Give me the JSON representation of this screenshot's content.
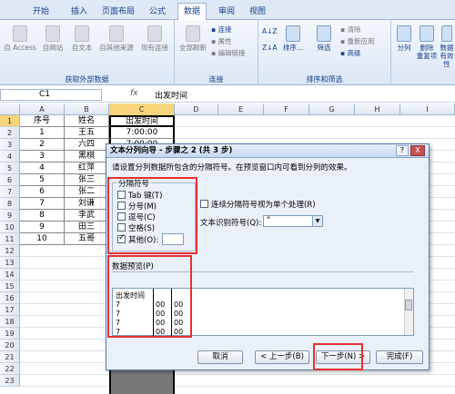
{
  "tabs": [
    {
      "label": "开始",
      "active": false
    },
    {
      "label": "插入",
      "active": false
    },
    {
      "label": "页面布局",
      "active": false
    },
    {
      "label": "公式",
      "active": false
    },
    {
      "label": "数据",
      "active": true
    },
    {
      "label": "审阅",
      "active": false
    },
    {
      "label": "视图",
      "active": false
    }
  ],
  "ribbon": {
    "groups": {
      "external": "获取外部数据",
      "connections": "连接",
      "sort_filter": "排序和筛选"
    },
    "buttons": {
      "from_access": "自 Access",
      "from_web": "自网站",
      "from_text": "自文本",
      "from_other": "自其他来源",
      "existing": "现有连接",
      "refresh_all": "全部刷新",
      "connections": "连接",
      "properties": "属性",
      "edit_links": "编辑链接",
      "sort": "排序...",
      "filter": "筛选",
      "clear": "清除",
      "reapply": "重新应用",
      "advanced": "高级",
      "text_to_columns": "分列",
      "remove_dup": "删除",
      "remove_dup2": "重复项",
      "data_valid": "数据",
      "data_valid2": "有效性"
    },
    "icons": {
      "sort_az": "A↓Z",
      "sort_za": "Z↓A"
    }
  },
  "formula_bar": {
    "cell_ref": "C1",
    "fx": "fx",
    "value": "出发时间"
  },
  "columns": [
    "A",
    "B",
    "C",
    "D",
    "E",
    "F",
    "G",
    "H",
    "I"
  ],
  "rows": [
    {
      "num": "1",
      "a": "序号",
      "b": "姓名",
      "c": "出发时间"
    },
    {
      "num": "2",
      "a": "1",
      "b": "王五",
      "c": "7:00:00"
    },
    {
      "num": "3",
      "a": "2",
      "b": "六四",
      "c": "7:00:00"
    },
    {
      "num": "4",
      "a": "3",
      "b": "黑棋",
      "c": ""
    },
    {
      "num": "5",
      "a": "4",
      "b": "红萍",
      "c": ""
    },
    {
      "num": "6",
      "a": "5",
      "b": "张三",
      "c": ""
    },
    {
      "num": "7",
      "a": "6",
      "b": "张二",
      "c": ""
    },
    {
      "num": "8",
      "a": "7",
      "b": "刘谦",
      "c": ""
    },
    {
      "num": "9",
      "a": "8",
      "b": "李武",
      "c": ""
    },
    {
      "num": "10",
      "a": "9",
      "b": "田三",
      "c": ""
    },
    {
      "num": "11",
      "a": "10",
      "b": "五哥",
      "c": ""
    },
    {
      "num": "12",
      "a": "",
      "b": "",
      "c": ""
    },
    {
      "num": "13",
      "a": "",
      "b": "",
      "c": ""
    },
    {
      "num": "14",
      "a": "",
      "b": "",
      "c": ""
    },
    {
      "num": "15",
      "a": "",
      "b": "",
      "c": ""
    },
    {
      "num": "16",
      "a": "",
      "b": "",
      "c": ""
    },
    {
      "num": "17",
      "a": "",
      "b": "",
      "c": ""
    },
    {
      "num": "18",
      "a": "",
      "b": "",
      "c": ""
    },
    {
      "num": "19",
      "a": "",
      "b": "",
      "c": ""
    },
    {
      "num": "20",
      "a": "",
      "b": "",
      "c": ""
    },
    {
      "num": "21",
      "a": "",
      "b": "",
      "c": ""
    },
    {
      "num": "22",
      "a": "",
      "b": "",
      "c": ""
    },
    {
      "num": "23",
      "a": "",
      "b": "",
      "c": ""
    }
  ],
  "dialog": {
    "title": "文本分列向导 - 步骤之 2 (共 3 步)",
    "help": "?",
    "close": "X",
    "instruction": "请设置分列数据所包含的分隔符号。在预览窗口内可看到分列的效果。",
    "delimiters_label": "分隔符号",
    "delimiters": [
      {
        "label": "Tab 键(T)",
        "checked": false
      },
      {
        "label": "分号(M)",
        "checked": false
      },
      {
        "label": "逗号(C)",
        "checked": false
      },
      {
        "label": "空格(S)",
        "checked": false
      },
      {
        "label": "其他(O):",
        "checked": true
      }
    ],
    "other_value": "",
    "consecutive_label": "连续分隔符号视为单个处理(R)",
    "consecutive_checked": false,
    "qualifier_label": "文本识别符号(Q):",
    "qualifier_value": "\"",
    "preview_label": "数据预览(P)",
    "preview_rows": [
      [
        "出发时间",
        "",
        ""
      ],
      [
        "7",
        "00",
        "00"
      ],
      [
        "7",
        "00",
        "00"
      ],
      [
        "7",
        "00",
        "00"
      ],
      [
        "7",
        "00",
        "00"
      ]
    ],
    "buttons": {
      "cancel": "取消",
      "back": "< 上一步(B)",
      "next": "下一步(N) >",
      "finish": "完成(F)"
    }
  },
  "colors": {
    "highlight_red": "#e53030",
    "dialog_bg": "#eaf0f8",
    "ribbon_text": "#15428b"
  }
}
